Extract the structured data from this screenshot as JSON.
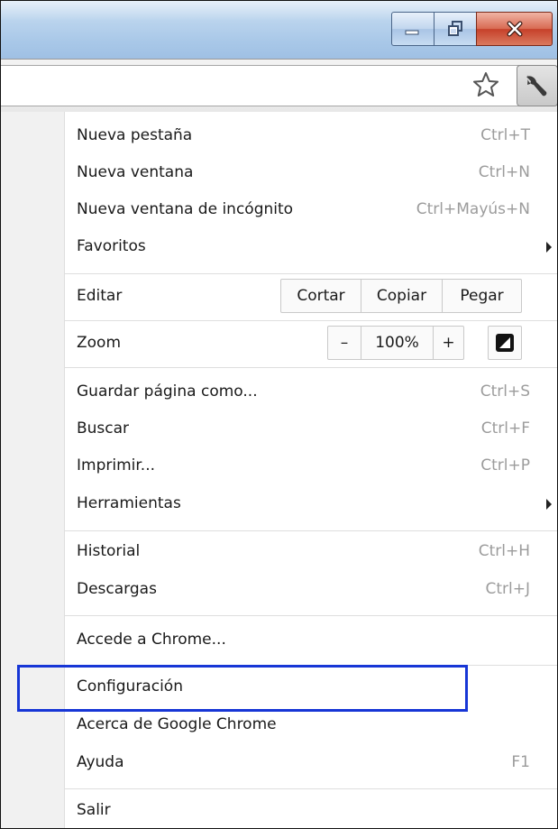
{
  "window_controls": {
    "minimize_icon": "minimize-icon",
    "maximize_icon": "maximize-icon",
    "close_icon": "close-icon"
  },
  "toolbar": {
    "bookmark_icon": "star-icon",
    "menu_icon": "wrench-icon"
  },
  "menu": {
    "nueva_pestana": {
      "label": "Nueva pestaña",
      "shortcut": "Ctrl+T"
    },
    "nueva_ventana": {
      "label": "Nueva ventana",
      "shortcut": "Ctrl+N"
    },
    "incognito": {
      "label": "Nueva ventana de incógnito",
      "shortcut": "Ctrl+Mayús+N"
    },
    "favoritos": {
      "label": "Favoritos"
    },
    "editar": {
      "label": "Editar",
      "cortar": "Cortar",
      "copiar": "Copiar",
      "pegar": "Pegar"
    },
    "zoom": {
      "label": "Zoom",
      "minus": "–",
      "value": "100%",
      "plus": "+"
    },
    "guardar": {
      "label": "Guardar página como...",
      "shortcut": "Ctrl+S"
    },
    "buscar": {
      "label": "Buscar",
      "shortcut": "Ctrl+F"
    },
    "imprimir": {
      "label": "Imprimir...",
      "shortcut": "Ctrl+P"
    },
    "herramientas": {
      "label": "Herramientas"
    },
    "historial": {
      "label": "Historial",
      "shortcut": "Ctrl+H"
    },
    "descargas": {
      "label": "Descargas",
      "shortcut": "Ctrl+J"
    },
    "acceder": {
      "label": "Accede a Chrome..."
    },
    "configuracion": {
      "label": "Configuración"
    },
    "acerca": {
      "label": "Acerca de Google Chrome"
    },
    "ayuda": {
      "label": "Ayuda",
      "shortcut": "F1"
    },
    "salir": {
      "label": "Salir"
    }
  },
  "colors": {
    "highlight_box": "#1736d6",
    "shortcut_text": "#9c9c9c"
  }
}
